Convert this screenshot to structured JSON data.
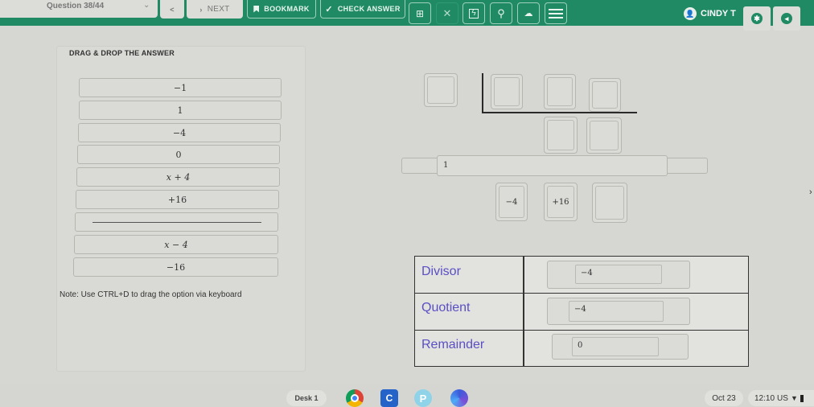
{
  "toolbar": {
    "question_label": "Question 38/44",
    "prev_label": "<",
    "next_label": "NEXT",
    "bookmark_label": "BOOKMARK",
    "check_answer_label": "CHECK ANSWER",
    "user_name": "CINDY T",
    "accent_color": "#1f8a63"
  },
  "left": {
    "title": "DRAG & DROP THE ANSWER",
    "options": [
      "−1",
      "1",
      "−4",
      "0",
      "x + 4",
      "+16",
      "",
      "x − 4",
      "−16"
    ],
    "note": "Note: Use CTRL+D to drag the option via keyboard"
  },
  "division": {
    "remainder_row_value": "1",
    "bottom_slots": [
      "−4",
      "+16",
      ""
    ]
  },
  "table": {
    "rows": [
      {
        "label": "Divisor",
        "value": "−4"
      },
      {
        "label": "Quotient",
        "value": "−4"
      },
      {
        "label": "Remainder",
        "value": "0"
      }
    ],
    "label_color": "#5a4fc4"
  },
  "taskbar": {
    "desk_label": "Desk 1",
    "date": "Oct 23",
    "time": "12:10",
    "locale": "US"
  }
}
